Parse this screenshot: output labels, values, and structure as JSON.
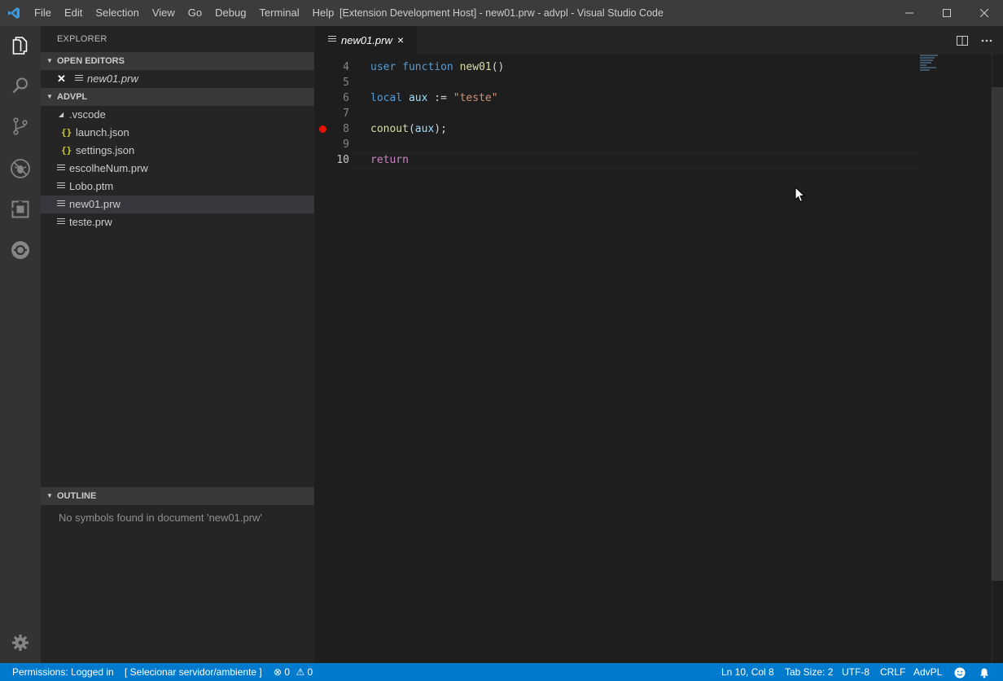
{
  "titlebar": {
    "menu": [
      "File",
      "Edit",
      "Selection",
      "View",
      "Go",
      "Debug",
      "Terminal",
      "Help"
    ],
    "title": "[Extension Development Host] - new01.prw - advpl - Visual Studio Code"
  },
  "activitybar": {
    "icons": [
      "files-icon",
      "search-icon",
      "source-control-icon",
      "debug-icon",
      "extensions-icon",
      "sync-icon"
    ],
    "bottom_icon": "gear-icon"
  },
  "sidebar": {
    "title": "EXPLORER",
    "open_editors": {
      "header": "OPEN EDITORS",
      "items": [
        {
          "label": "new01.prw"
        }
      ]
    },
    "workspace": {
      "header": "ADVPL",
      "folder": ".vscode",
      "folder_children": [
        {
          "label": "launch.json"
        },
        {
          "label": "settings.json"
        }
      ],
      "files": [
        {
          "label": "escolheNum.prw"
        },
        {
          "label": "Lobo.ptm"
        },
        {
          "label": "new01.prw"
        },
        {
          "label": "teste.prw"
        }
      ]
    },
    "outline": {
      "header": "OUTLINE",
      "message": "No symbols found in document 'new01.prw'"
    }
  },
  "editor": {
    "tab": {
      "label": "new01.prw",
      "close": "×"
    },
    "lines": [
      {
        "number": "4",
        "tokens": [
          [
            "kw",
            "user"
          ],
          [
            "pun",
            " "
          ],
          [
            "kw",
            "function"
          ],
          [
            "pun",
            " "
          ],
          [
            "fn",
            "new01"
          ],
          [
            "pun",
            "()"
          ]
        ]
      },
      {
        "number": "5",
        "tokens": []
      },
      {
        "number": "6",
        "tokens": [
          [
            "kw",
            "local"
          ],
          [
            "pun",
            " "
          ],
          [
            "var",
            "aux"
          ],
          [
            "pun",
            " := "
          ],
          [
            "str",
            "\"teste\""
          ]
        ]
      },
      {
        "number": "7",
        "tokens": []
      },
      {
        "number": "8",
        "tokens": [
          [
            "fn",
            "conout"
          ],
          [
            "pun",
            "("
          ],
          [
            "var",
            "aux"
          ],
          [
            "pun",
            ");"
          ]
        ],
        "breakpoint": true
      },
      {
        "number": "9",
        "tokens": []
      },
      {
        "number": "10",
        "tokens": [
          [
            "ret",
            "return"
          ]
        ],
        "active": true
      }
    ]
  },
  "statusbar": {
    "permissions": "Permissions: Logged in",
    "server": "[ Selecionar servidor/ambiente ]",
    "errors": "0",
    "warnings": "0",
    "position": "Ln 10, Col 8",
    "tab_size": "Tab Size: 2",
    "encoding": "UTF-8",
    "eol": "CRLF",
    "language": "AdvPL"
  },
  "colors": {
    "statusbar": "#007acc",
    "activitybar": "#333333",
    "sidebar": "#252526",
    "editor": "#1e1e1e",
    "breakpoint": "#e51400"
  }
}
